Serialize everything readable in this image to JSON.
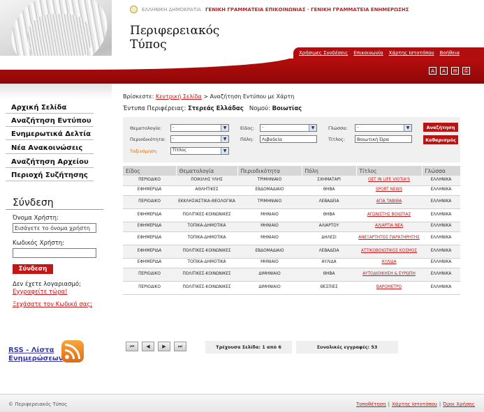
{
  "header": {
    "gov_text": "ΕΛΛΗΝΙΚΗ ΔΗΜΟΚΡΑΤΙΑ",
    "gov_red": "ΓΕΝΙΚΗ ΓΡΑΜΜΑΤΕΙΑ ΕΠΙΚΟΙΝΩΝΙΑΣ · ΓΕΝΙΚΗ ΓΡΑΜΜΑΤΕΙΑ ΕΝΗΜΕΡΩΣΗΣ",
    "title_line1": "Περιφερειακός",
    "title_line2": "Τύπος",
    "top_links": [
      "Χρήσιμες Συνδέσεις",
      "Επικοινωνία",
      "Χάρτης Ιστοτόπου",
      "Βοήθεια"
    ],
    "tool_icons": [
      "A",
      "A",
      "✉",
      "⎙"
    ]
  },
  "sidebar": {
    "nav": [
      "Αρχική Σελίδα",
      "Αναζήτηση Εντύπου",
      "Ενημερωτικά Δελτία",
      "Νέα Ανακοινώσεις",
      "Αναζήτηση Αρχείου",
      "Περιοχή Συζήτησης"
    ],
    "login_title": "Σύνδεση",
    "username_label": "Όνομα Χρήστη:",
    "username_value": "Εισάγετε το όνομα χρήστη",
    "password_label": "Κωδικός Χρήστη:",
    "login_button": "Σύνδεση",
    "no_account": "Δεν έχετε λογαριασμό;",
    "register_link": "Εγγραφείτε τώρα!",
    "forgot_link": "Ξεχάσατε τον Κωδικό σας;",
    "rss_line1": "RSS - Λίστα",
    "rss_line2": "Ενημερώσεων"
  },
  "breadcrumb": {
    "prefix": "Βρίσκεστε:",
    "home": "Κεντρική Σελίδα",
    "current": "> Αναζήτηση Εντύπου με Χάρτη"
  },
  "region": {
    "label": "Έντυπα Περιφέρειας:",
    "region": "Στερεάς Ελλάδας",
    "pref_label": "Νομού:",
    "prefecture": "Βοιωτίας"
  },
  "filters": {
    "theme_label": "Θεματολογία:",
    "theme_value": "-",
    "kind_label": "Είδος:",
    "kind_value": "-",
    "lang_label": "Γλώσσα:",
    "lang_value": "-",
    "period_label": "Περιοδικότητα:",
    "period_value": "-",
    "city_label": "Πόλη:",
    "city_value": "Λιβαδεία",
    "title_label": "Τίτλος:",
    "title_value": "Βοιωτική Ώρα",
    "sort_label": "Ταξινόμηση",
    "sort_value": "Τίτλος",
    "search_button": "Αναζήτηση",
    "clear_button": "Καθαρισμός"
  },
  "table": {
    "headers": [
      "Είδος",
      "Θεματολογία",
      "Περιοδικότητα",
      "Πόλη",
      "Τίτλος",
      "Γλώσσα"
    ],
    "rows": [
      [
        "ΠΕΡΙΟΔΙΚΟ",
        "ΠΟΙΚΙΛΗΣ ΥΛΗΣ",
        "ΤΡΙΜΗΝΙΑΙΟ",
        "ΣΧΗΜΑΤΑΡΙ",
        "GET IN LIFE VIOTIA'S",
        "ΕΛΛΗΝΙΚΑ"
      ],
      [
        "ΕΦΗΜΕΡΙΔΑ",
        "ΑΘΛΗΤΙΚΕΣ",
        "ΕΒΔΟΜΑΔΙΑΙΟ",
        "ΘΗΒΑ",
        "SPORT NEWS",
        "ΕΛΛΗΝΙΚΑ"
      ],
      [
        "ΠΕΡΙΟΔΙΚΟ",
        "ΕΚΚΛΗΣΙΑΣΤΙΚΑ-ΘΕΟΛΟΓΙΚΑ",
        "ΤΡΙΜΗΝΙΑΙΟ",
        "ΛΕΒΑΔΕΙΑ",
        "ΑΓΙΑ ΤΑΒΙΘΑ",
        "ΕΛΛΗΝΙΚΑ"
      ],
      [
        "ΕΦΗΜΕΡΙΔΑ",
        "ΠΟΛΙΤΙΚΕΣ-ΚΟΙΝΩΝΙΚΕΣ",
        "ΜΗΝΙΑΙΟ",
        "ΘΗΒΑ",
        "ΑΓΩΝΙΣΤΗΣ ΒΟΙΩΤΙΑΣ",
        "ΕΛΛΗΝΙΚΑ"
      ],
      [
        "ΕΦΗΜΕΡΙΔΑ",
        "ΤΟΠΙΚΑ-ΔΗΜΟΤΙΚΑ",
        "ΜΗΝΙΑΙΟ",
        "ΑΛΙΑΡΤΟΥ",
        "ΑΛΙΑΡΤΙΑ ΝΕΑ",
        "ΕΛΛΗΝΙΚΑ"
      ],
      [
        "ΕΦΗΜΕΡΙΔΑ",
        "ΤΟΠΙΚΑ-ΔΗΜΟΤΙΚΑ",
        "ΜΗΝΙΑΙΟ",
        "ΔΗΛΕΣΙ",
        "ΑΝΕΞΑΡΤΗΤΟΣ ΠΑΡΑΤΗΡΗΤΗΣ",
        "ΕΛΛΗΝΙΚΑ"
      ],
      [
        "ΕΦΗΜΕΡΙΔΑ",
        "ΠΟΛΙΤΙΚΕΣ-ΚΟΙΝΩΝΙΚΕΣ",
        "ΕΒΔΟΜΑΔΙΑΙΟ",
        "ΛΕΒΑΔΕΙΑ",
        "ΑΤΤΙΚΟΒΟΙΩΤΙΚΟΣ ΚΟΣΜΟΣ",
        "ΕΛΛΗΝΙΚΑ"
      ],
      [
        "ΕΦΗΜΕΡΙΔΑ",
        "ΤΟΠΙΚΑ-ΔΗΜΟΤΙΚΑ",
        "ΜΗΝΙΑΙΟ",
        "ΑΥΛΙΔΑ",
        "ΑΥΛΙΔΑ",
        "ΕΛΛΗΝΙΚΑ"
      ],
      [
        "ΠΕΡΙΟΔΙΚΟ",
        "ΠΟΛΙΤΙΚΕΣ-ΚΟΙΝΩΝΙΚΕΣ",
        "ΔΙΜΗΝΙΑΙΟ",
        "ΘΗΒΑ",
        "ΑΥΤΟΔΙΟΙΚΗΣΗ & ΕΥΡΩΠΗ",
        "ΕΛΛΗΝΙΚΑ"
      ],
      [
        "ΠΕΡΙΟΔΙΚΟ",
        "ΠΟΛΙΤΙΚΕΣ-ΚΟΙΝΩΝΙΚΕΣ",
        "ΔΙΜΗΝΙΑΙΟ",
        "ΘΕΣΠΙΕΣ",
        "ΒΑΡΟΜΕΤΡΟ",
        "ΕΛΛΗΝΙΚΑ"
      ]
    ]
  },
  "pager": {
    "first": "⏮",
    "prev": "◀",
    "next": "▶",
    "last": "⏭",
    "current_page": "Τρέχουσα Σελίδα: 1 από 6",
    "total": "Συνολικές εγγραφές:  53"
  },
  "footer": {
    "copyright": "© Περιφερειακός Τύπος",
    "links": [
      "Τοποθέτηση",
      "Χάρτης Ιστοτόπου",
      "Όροι Χρήσης"
    ]
  }
}
